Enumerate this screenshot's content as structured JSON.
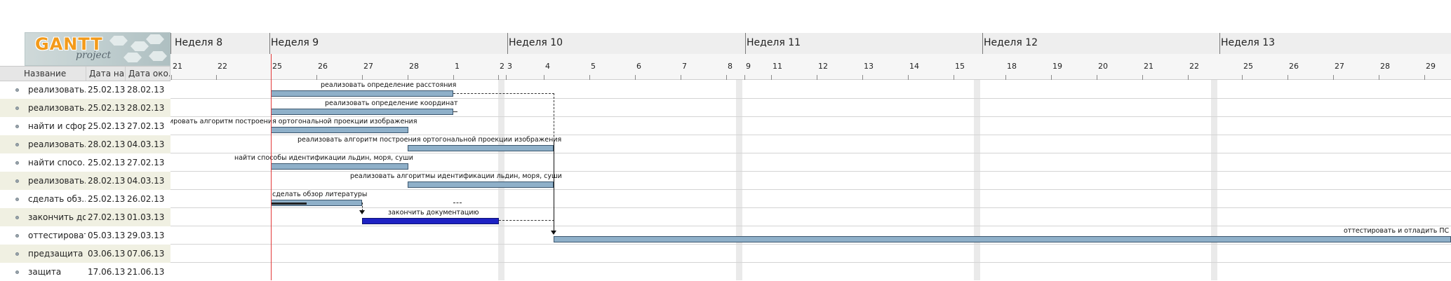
{
  "logo": {
    "main": "GANTT",
    "sub": "project"
  },
  "columns": {
    "name": "Название",
    "start": "Дата на...",
    "end": "Дата око..."
  },
  "tasks": [
    {
      "name": "реализовать...",
      "start": "25.02.13",
      "end": "28.02.13",
      "bar_label": "реализовать определение расстояния"
    },
    {
      "name": "реализовать...",
      "start": "25.02.13",
      "end": "28.02.13",
      "bar_label": "реализовать определение координат"
    },
    {
      "name": "найти и сфор...",
      "start": "25.02.13",
      "end": "27.02.13",
      "bar_label": "ировать алгоритм построения ортогональной проекции изображения"
    },
    {
      "name": "реализовать...",
      "start": "28.02.13",
      "end": "04.03.13",
      "bar_label": "реализовать алгоритм построения ортогональной проекции изображения"
    },
    {
      "name": "найти спосо...",
      "start": "25.02.13",
      "end": "27.02.13",
      "bar_label": "найти способы идентификации льдин, моря, суши"
    },
    {
      "name": "реализовать...",
      "start": "28.02.13",
      "end": "04.03.13",
      "bar_label": "реализовать алгоритмы идентификации льдин, моря, суши"
    },
    {
      "name": "сделать обз...",
      "start": "25.02.13",
      "end": "26.02.13",
      "bar_label": "сделать обзор литературы"
    },
    {
      "name": "закончить до...",
      "start": "27.02.13",
      "end": "01.03.13",
      "bar_label": "закончить документацию"
    },
    {
      "name": "оттестироват...",
      "start": "05.03.13",
      "end": "29.03.13",
      "bar_label": "оттестировать и отладить ПС"
    },
    {
      "name": "предзащита",
      "start": "03.06.13",
      "end": "07.06.13",
      "bar_label": ""
    },
    {
      "name": "защита",
      "start": "17.06.13",
      "end": "21.06.13",
      "bar_label": ""
    }
  ],
  "weeks": [
    "Неделя 8",
    "Неделя 9",
    "Неделя 10",
    "Неделя 11",
    "Неделя 12",
    "Неделя 13"
  ],
  "days": [
    "21",
    "22",
    "25",
    "26",
    "27",
    "28",
    "1",
    "2",
    "3",
    "4",
    "5",
    "6",
    "7",
    "8",
    "9",
    "11",
    "12",
    "13",
    "14",
    "15",
    "18",
    "19",
    "20",
    "21",
    "22",
    "25",
    "26",
    "27",
    "28",
    "29"
  ],
  "colors": {
    "bar": "#8fb0c9",
    "bar_border": "#3b566e",
    "critical_bar": "#1e22c4",
    "today_line": "#e23a3a",
    "alt_row": "#f0f0e2"
  }
}
